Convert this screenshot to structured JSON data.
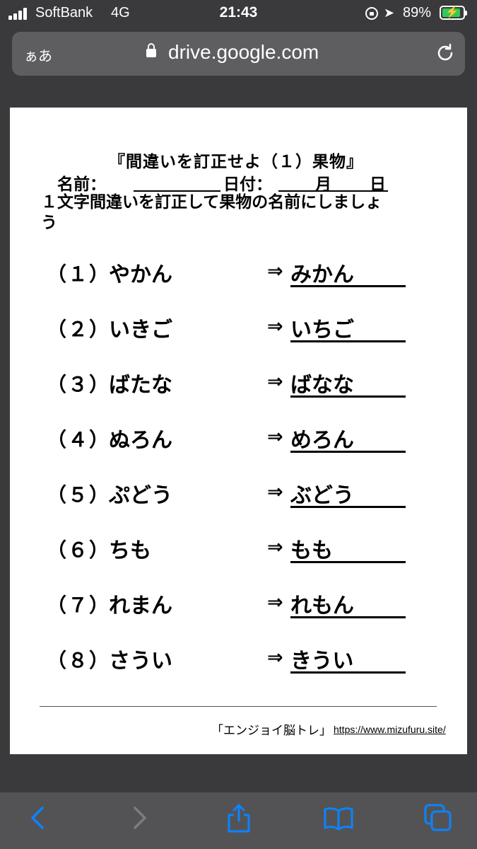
{
  "status_bar": {
    "carrier": "SoftBank",
    "network": "4G",
    "time": "21:43",
    "battery_percent": "89%",
    "battery_level": 0.89,
    "icons": [
      "signal-icon",
      "lock-rotation-icon",
      "location-icon",
      "battery-charging-icon"
    ]
  },
  "browser": {
    "text_size_label": "ぁあ",
    "url": "drive.google.com",
    "icons": [
      "padlock-icon",
      "reload-icon"
    ]
  },
  "worksheet": {
    "title": "『間違いを訂正せよ（１）果物』",
    "name_label": "名前：",
    "date_label": "日付：",
    "month_label": "月",
    "day_label": "日",
    "instructions": "１文字間違いを訂正して果物の名前にしましょう",
    "arrow": "⇒",
    "questions": [
      {
        "number": "（１）",
        "word": "やかん",
        "answer": "みかん"
      },
      {
        "number": "（２）",
        "word": "いきご",
        "answer": "いちご"
      },
      {
        "number": "（３）",
        "word": "ばたな",
        "answer": "ばなな"
      },
      {
        "number": "（４）",
        "word": "ぬろん",
        "answer": "めろん"
      },
      {
        "number": "（５）",
        "word": "ぷどう",
        "answer": "ぶどう"
      },
      {
        "number": "（６）",
        "word": "ちも",
        "answer": "もも"
      },
      {
        "number": "（７）",
        "word": "れまん",
        "answer": "れもん"
      },
      {
        "number": "（８）",
        "word": "さうい",
        "answer": "きうい"
      }
    ],
    "footer_brand": "「エンジョイ脳トレ」",
    "footer_url": "https://www.mizufuru.site/"
  },
  "toolbar": {
    "icons": [
      "back-icon",
      "forward-icon",
      "share-icon",
      "bookmarks-icon",
      "tabs-icon"
    ],
    "accent_color": "#0a84ff",
    "disabled_color": "#7c7c80"
  }
}
